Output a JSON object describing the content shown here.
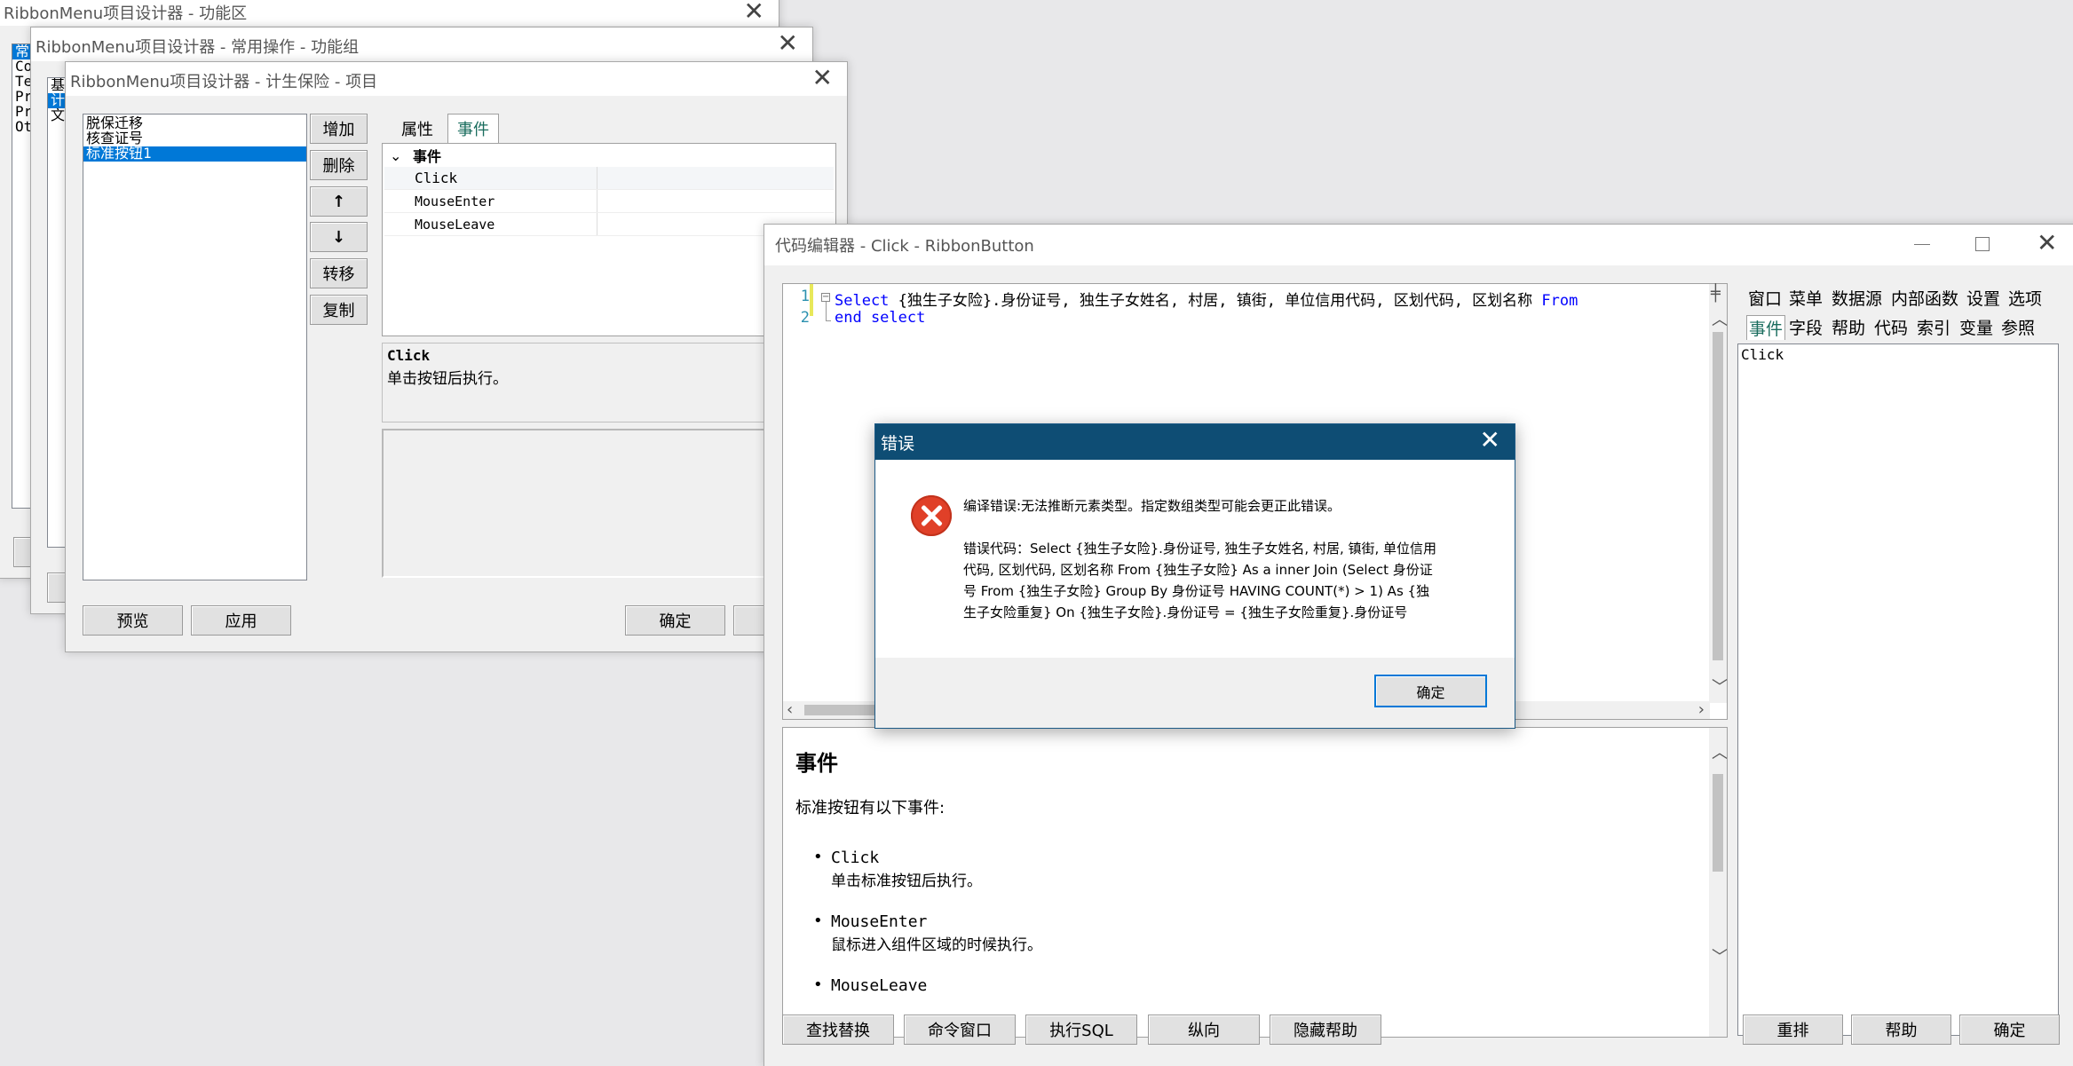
{
  "win1": {
    "title": "RibbonMenu项目设计器 - 功能区",
    "list_items": [
      "常",
      "Co",
      "Te",
      "Pr",
      "Pr",
      "Ot"
    ]
  },
  "win2": {
    "title": "RibbonMenu项目设计器 - 常用操作 - 功能组",
    "list_items": [
      "基",
      "计",
      "文"
    ]
  },
  "win3": {
    "title": "RibbonMenu项目设计器 - 计生保险 - 项目",
    "list_items": [
      "脱保迁移",
      "核查证号",
      "标准按钮1"
    ],
    "side_buttons": [
      "增加",
      "删除",
      "↑",
      "↓",
      "转移",
      "复制"
    ],
    "tabs": [
      "属性",
      "事件"
    ],
    "prop_group": "事件",
    "prop_rows": [
      "Click",
      "MouseEnter",
      "MouseLeave"
    ],
    "desc_name": "Click",
    "desc_text": "单击按钮后执行。",
    "buttons": {
      "preview": "预览",
      "apply": "应用",
      "ok": "确定"
    }
  },
  "editor": {
    "title": "代码编辑器 - Click - RibbonButton",
    "lines": [
      {
        "num": "1",
        "kw": "Select ",
        "text": "{独生子女险}.身份证号, 独生子女姓名, 村居, 镇街, 单位信用代码, 区划代码, 区划名称 ",
        "kw2": "From"
      },
      {
        "num": "2",
        "kw": "end select",
        "text": "",
        "kw2": ""
      }
    ],
    "right_tabs_row1": [
      "窗口",
      "菜单",
      "数据源",
      "内部函数",
      "设置",
      "选项"
    ],
    "right_tabs_row2": [
      "事件",
      "字段",
      "帮助",
      "代码",
      "索引",
      "变量",
      "参照"
    ],
    "right_list": [
      "Click"
    ],
    "help": {
      "heading": "事件",
      "intro": "标准按钮有以下事件:",
      "events": [
        {
          "name": "Click",
          "desc": "单击标准按钮后执行。"
        },
        {
          "name": "MouseEnter",
          "desc": "鼠标进入组件区域的时候执行。"
        },
        {
          "name": "MouseLeave",
          "desc": ""
        }
      ]
    },
    "bottom_buttons": [
      "查找替换",
      "命令窗口",
      "执行SQL",
      "纵向",
      "隐藏帮助"
    ],
    "right_buttons": [
      "重排",
      "帮助",
      "确定"
    ]
  },
  "dialog": {
    "title": "错误",
    "message": "编译错误:无法推断元素类型。指定数组类型可能会更正此错误。",
    "code_lines": [
      "错误代码：Select {独生子女险}.身份证号, 独生子女姓名, 村居, 镇街, 单位信用",
      "代码, 区划代码, 区划名称 From {独生子女险} As a inner Join (Select 身份证",
      "号 From {独生子女险} Group By 身份证号 HAVING COUNT(*) > 1) As {独",
      "生子女险重复} On {独生子女险}.身份证号 = {独生子女险重复}.身份证号"
    ],
    "ok": "确定"
  }
}
